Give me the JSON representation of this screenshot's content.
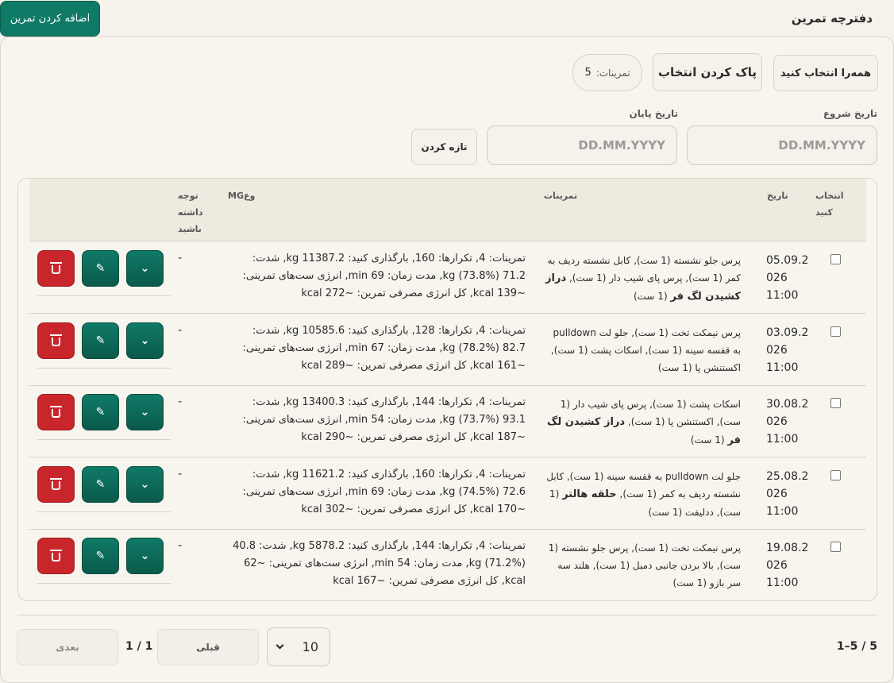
{
  "header": {
    "add_button": "اضافه کردن تمرین",
    "title": "دفترچه تمرین"
  },
  "toolbar": {
    "select_all": "همه‌را انتخاب کنید",
    "clear_selection": "پاک کردن انتخاب",
    "count_label": "تمرینات:",
    "count_value": "5"
  },
  "filters": {
    "start_label": "تاریخ شروع",
    "end_label": "تاریخ پایان",
    "start_placeholder": "DD.MM.YYYY",
    "end_placeholder": "DD.MM.YYYY",
    "refresh": "تازه کردن"
  },
  "table": {
    "headers": {
      "select": "انتخاب\nکنید",
      "date": "تاریخ",
      "exercises": "تمرینات",
      "volume": "MGوع",
      "note": "توجه\nداشته\nباشید"
    },
    "rows": [
      {
        "date": "05.09.2\n026\n11:00",
        "exercises_html": "پرس جلو نشسته (1 ست), کابل نشسته ردیف به کمر (1 ست), پرس پای شیب دار (1 ست), <b>دراز کشیدن لگ فر</b> (1 ست)",
        "volume": "تمرینات: 4, تکرارها: 160, بارگذاری کنید: 11387.2 kg, شدت: 71.2 kg (73.8%), مدت زمان: 69 min, انرژی ست‌های تمرینی: ~139 kcal, کل انرژی مصرفی تمرین: ~272 kcal",
        "note": "-"
      },
      {
        "date": "03.09.2\n026\n11:00",
        "exercises_html": "پرس نیمکت تخت (1 ست), جلو لت pulldown به قفسه سینه (1 ست), اسکات پشت (1 ست), اکستنشن پا (1 ست)",
        "volume": "تمرینات: 4, تکرارها: 128, بارگذاری کنید: 10585.6 kg, شدت: 82.7 kg (78.2%), مدت زمان: 67 min, انرژی ست‌های تمرینی: ~161 kcal, کل انرژی مصرفی تمرین: ~289 kcal",
        "note": "-"
      },
      {
        "date": "30.08.2\n026\n11:00",
        "exercises_html": "اسکات پشت (1 ست), پرس پای شیب دار (1 ست), اکستنشن پا (1 ست), <b>دراز کشیدن لگ فر</b> (1 ست)",
        "volume": "تمرینات: 4, تکرارها: 144, بارگذاری کنید: 13400.3 kg, شدت: 93.1 kg (73.7%), مدت زمان: 54 min, انرژی ست‌های تمرینی: ~187 kcal, کل انرژی مصرفی تمرین: ~290 kcal",
        "note": "-"
      },
      {
        "date": "25.08.2\n026\n11:00",
        "exercises_html": "جلو لت pulldown به قفسه سینه (1 ست), کابل نشسته ردیف به کمر (1 ست), <b>حلقه هالتر</b> (1 ست), ددلیفت (1 ست)",
        "volume": "تمرینات: 4, تکرارها: 160, بارگذاری کنید: 11621.2 kg, شدت: 72.6 kg (74.5%), مدت زمان: 69 min, انرژی ست‌های تمرینی: ~170 kcal, کل انرژی مصرفی تمرین: ~302 kcal",
        "note": "-"
      },
      {
        "date": "19.08.2\n026\n11:00",
        "exercises_html": "پرس نیمکت تخت (1 ست), پرس جلو نشسته (1 ست), بالا بردن جانبی دمبل (1 ست), هلند سه سر بازو (1 ست)",
        "volume": "تمرینات: 4, تکرارها: 144, بارگذاری کنید: 5878.2 kg, شدت: 40.8 kg (71.2%), مدت زمان: 54 min, انرژی ست‌های تمرینی: ~62 kcal, کل انرژی مصرفی تمرین: ~167 kcal",
        "note": "-"
      }
    ]
  },
  "icons": {
    "expand": "chevron-down-icon",
    "edit": "pencil-icon",
    "delete": "trash-icon"
  },
  "pagination": {
    "range": "1–5 / 5",
    "page_size": "10",
    "prev": "قبلی",
    "page_indicator": "1 / 1",
    "next": "بعدی"
  },
  "colors": {
    "accent": "#0f7a66",
    "danger": "#c9262c",
    "background": "#f4f2ea"
  }
}
